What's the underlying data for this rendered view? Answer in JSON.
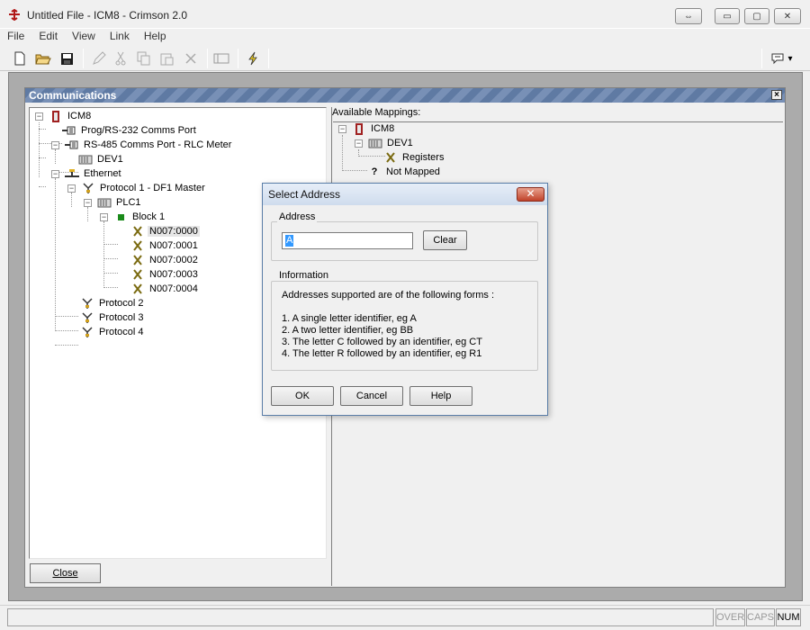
{
  "window": {
    "title": "Untitled File - ICM8 - Crimson 2.0",
    "min_label": "▭",
    "max_label": "▢",
    "close_label": "✕",
    "restore_label": "⇔"
  },
  "menu": [
    "File",
    "Edit",
    "View",
    "Link",
    "Help"
  ],
  "toolbar": {
    "icons": [
      "new-file-icon",
      "open-folder-icon",
      "save-icon",
      "pencil-icon",
      "cut-icon",
      "copy-icon",
      "paste-icon",
      "delete-icon",
      "panel-icon",
      "lightning-icon",
      "speech-bubble-icon"
    ],
    "dropdown_glyph": "▾"
  },
  "comm_panel": {
    "title": "Communications",
    "close_glyph": "×",
    "tree": [
      {
        "label": "ICM8",
        "icon": "device-icon",
        "expander": "−"
      },
      {
        "label": "Prog/RS-232 Comms Port",
        "icon": "port-icon",
        "expander": ""
      },
      {
        "label": "RS-485 Comms Port - RLC Meter",
        "icon": "port-icon",
        "expander": "−"
      },
      {
        "label": "DEV1",
        "icon": "device-module-icon",
        "expander": ""
      },
      {
        "label": "Ethernet",
        "icon": "ethernet-icon",
        "expander": "−"
      },
      {
        "label": "Protocol 1 - DF1 Master",
        "icon": "protocol-icon",
        "expander": "−"
      },
      {
        "label": "PLC1",
        "icon": "device-module-icon",
        "expander": "−"
      },
      {
        "label": "Block 1",
        "icon": "block-icon",
        "expander": "−"
      },
      {
        "label": "N007:0000",
        "icon": "tag-icon",
        "expander": ""
      },
      {
        "label": "N007:0001",
        "icon": "tag-icon",
        "expander": ""
      },
      {
        "label": "N007:0002",
        "icon": "tag-icon",
        "expander": ""
      },
      {
        "label": "N007:0003",
        "icon": "tag-icon",
        "expander": ""
      },
      {
        "label": "N007:0004",
        "icon": "tag-icon",
        "expander": ""
      },
      {
        "label": "Protocol 2",
        "icon": "protocol-icon",
        "expander": ""
      },
      {
        "label": "Protocol 3",
        "icon": "protocol-icon",
        "expander": ""
      },
      {
        "label": "Protocol 4",
        "icon": "protocol-icon",
        "expander": ""
      }
    ],
    "available_label": "Available Mappings:",
    "mappings": [
      {
        "label": "ICM8",
        "expander": "−"
      },
      {
        "label": "DEV1",
        "expander": "−"
      },
      {
        "label": "Registers",
        "expander": ""
      },
      {
        "label": "Not Mapped",
        "expander": ""
      }
    ],
    "not_mapped_glyph": "?",
    "close_button": "Close"
  },
  "dialog": {
    "title": "Select Address",
    "close_glyph": "✕",
    "address_group": "Address",
    "address_value": "A",
    "clear_button": "Clear",
    "info_group": "Information",
    "info_lines": [
      "Addresses supported are of the following forms :",
      "1. A single letter identifier, eg A",
      "2. A two letter identifier, eg BB",
      "3. The letter C followed by an identifier, eg CT",
      "4. The letter R followed by an identifier, eg R1"
    ],
    "ok_button": "OK",
    "cancel_button": "Cancel",
    "help_button": "Help"
  },
  "status": {
    "over": "OVER",
    "caps": "CAPS",
    "num": "NUM"
  },
  "colors": {
    "panel_title": "#6a84ad",
    "selection": "#3399ff",
    "dialog_border": "#5b7ea8"
  }
}
